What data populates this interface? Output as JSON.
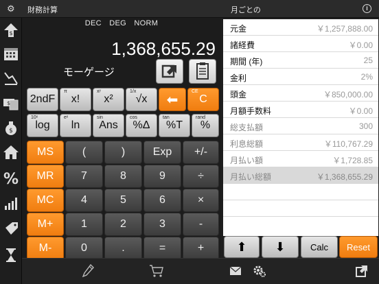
{
  "header": {
    "left_title": "財務計算",
    "right_title": "月ごとの"
  },
  "display": {
    "modes": [
      "DEC",
      "DEG",
      "NORM"
    ],
    "value": "1,368,655.29",
    "label": "モーゲージ"
  },
  "keys": {
    "row1": [
      {
        "main": "2ndF",
        "sup": ""
      },
      {
        "main": "x!",
        "sup": "π"
      },
      {
        "main": "x²",
        "sup": "xʸ"
      },
      {
        "main": "√x",
        "sup": "1/x"
      },
      {
        "main": "⬅",
        "sup": ""
      },
      {
        "main": "C",
        "sup": "CE"
      }
    ],
    "row2": [
      {
        "main": "log",
        "sup": "10ˣ"
      },
      {
        "main": "ln",
        "sup": "eˣ"
      },
      {
        "main": "Ans",
        "sup": "sin"
      },
      {
        "main": "%Δ",
        "sup": "cos"
      },
      {
        "main": "%T",
        "sup": "tan"
      },
      {
        "main": "%",
        "sup": "rand"
      }
    ],
    "memory": [
      "MS",
      "MR",
      "MC",
      "M+",
      "M-"
    ],
    "grid": [
      [
        "(",
        ")",
        "Exp",
        "+/-"
      ],
      [
        "7",
        "8",
        "9",
        "÷"
      ],
      [
        "4",
        "5",
        "6",
        "×"
      ],
      [
        "1",
        "2",
        "3",
        "-"
      ],
      [
        "0",
        ".",
        "=",
        "+"
      ]
    ]
  },
  "mortgage": {
    "rows": [
      {
        "label": "元金",
        "value": "￥1,257,888.00"
      },
      {
        "label": "諸経費",
        "value": "￥0.00"
      },
      {
        "label": "期間 (年)",
        "value": "25"
      },
      {
        "label": "金利",
        "value": "2%"
      },
      {
        "label": "頭金",
        "value": "￥850,000.00"
      },
      {
        "label": "月額手数料",
        "value": "￥0.00"
      },
      {
        "label": "総支払額",
        "value": "300"
      },
      {
        "label": "利息総額",
        "value": "￥110,767.29"
      },
      {
        "label": "月払い額",
        "value": "￥1,728.85"
      },
      {
        "label": "月払い総額",
        "value": "￥1,368,655.29"
      }
    ]
  },
  "actions": {
    "up": "⬆",
    "down": "⬇",
    "calc": "Calc",
    "reset": "Reset"
  },
  "colors": {
    "orange": "#f5871e",
    "gray_key": "#d4d4d4",
    "dark_key": "#4a4a4a"
  }
}
